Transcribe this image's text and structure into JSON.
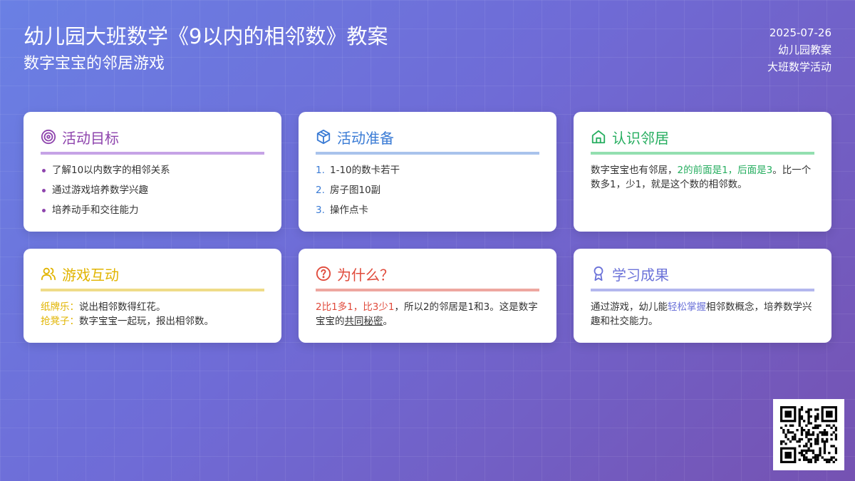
{
  "header": {
    "title": "幼儿园大班数学《9以内的相邻数》教案",
    "subtitle": "数字宝宝的邻居游戏",
    "date": "2025-07-26",
    "meta1": "幼儿园教案",
    "meta2": "大班数学活动"
  },
  "colors": {
    "purple": "#8e44ad",
    "blue": "#3a7bd5",
    "green": "#27ae60",
    "yellow": "#e1b400",
    "red": "#e04a3b",
    "indigo": "#6c73d9"
  },
  "cards": {
    "goals": {
      "icon": "target-icon",
      "title": "活动目标",
      "items": [
        "了解10以内数字的相邻关系",
        "通过游戏培养数学兴趣",
        "培养动手和交往能力"
      ]
    },
    "prep": {
      "icon": "box-icon",
      "title": "活动准备",
      "items": [
        {
          "n": "1.",
          "text": "1-10的数卡若干"
        },
        {
          "n": "2.",
          "text": "房子图10副"
        },
        {
          "n": "3.",
          "text": "操作点卡"
        }
      ]
    },
    "neighbors": {
      "icon": "home-icon",
      "title": "认识邻居",
      "text_before": "数字宝宝也有邻居，",
      "highlight": "2的前面是1，后面是3",
      "text_after": "。比一个数多1，少1，就是这个数的相邻数。"
    },
    "games": {
      "icon": "users-icon",
      "title": "游戏互动",
      "line1_label": "纸牌乐：",
      "line1_text": "说出相邻数得红花。",
      "line2_label": "抢凳子：",
      "line2_text": "数字宝宝一起玩，报出相邻数。"
    },
    "why": {
      "icon": "question-circle-icon",
      "title": "为什么？",
      "highlight": "2比1多1，比3少1",
      "text_mid": "，所以2的邻居是1和3。这是数字宝宝的",
      "underline": "共同秘密",
      "text_end": "。"
    },
    "outcome": {
      "icon": "award-icon",
      "title": "学习成果",
      "text_before": "通过游戏，幼儿能",
      "highlight": "轻松掌握",
      "text_after": "相邻数概念，培养数学兴趣和社交能力。"
    }
  }
}
